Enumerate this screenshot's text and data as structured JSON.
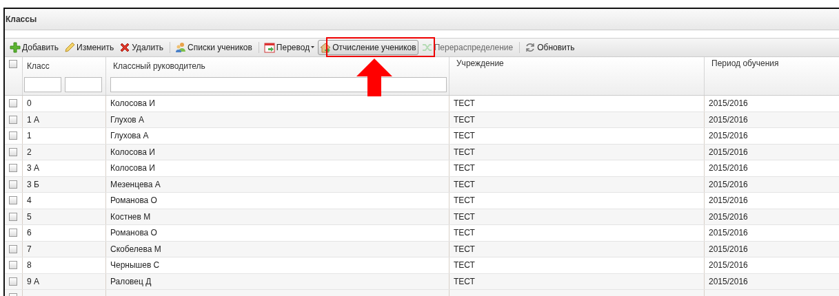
{
  "window": {
    "title": "Классы"
  },
  "toolbar": [
    {
      "kind": "button",
      "label": "Добавить",
      "disabled": false,
      "pressed": false,
      "dropdown": false
    },
    {
      "kind": "button",
      "label": "Изменить",
      "disabled": false,
      "pressed": false,
      "dropdown": false
    },
    {
      "kind": "button",
      "label": "Удалить",
      "disabled": false,
      "pressed": false,
      "dropdown": false
    },
    {
      "kind": "separator"
    },
    {
      "kind": "button",
      "label": "Списки учеников",
      "disabled": false,
      "pressed": false,
      "dropdown": false
    },
    {
      "kind": "separator"
    },
    {
      "kind": "button",
      "label": "Перевод",
      "disabled": false,
      "pressed": false,
      "dropdown": true
    },
    {
      "kind": "button",
      "label": "Отчисление учеников",
      "disabled": false,
      "pressed": true,
      "dropdown": false
    },
    {
      "kind": "button",
      "label": "Перераспределение",
      "disabled": true,
      "pressed": false,
      "dropdown": false
    },
    {
      "kind": "separator"
    },
    {
      "kind": "button",
      "label": "Обновить",
      "disabled": false,
      "pressed": false,
      "dropdown": false
    }
  ],
  "table": {
    "select_all_checked": false,
    "columns": [
      "Класс",
      "Классный руководитель",
      "Учреждение",
      "Период обучения"
    ],
    "rows": [
      {
        "checked": false,
        "cells": [
          "0",
          "Колосова И",
          "ТЕСТ",
          "2015/2016"
        ]
      },
      {
        "checked": false,
        "cells": [
          "1 А",
          "Глухов А",
          "ТЕСТ",
          "2015/2016"
        ]
      },
      {
        "checked": false,
        "cells": [
          "1",
          "Глухова А",
          "ТЕСТ",
          "2015/2016"
        ]
      },
      {
        "checked": false,
        "cells": [
          "2",
          "Колосова И",
          "ТЕСТ",
          "2015/2016"
        ]
      },
      {
        "checked": false,
        "cells": [
          "3 А",
          "Колосова И",
          "ТЕСТ",
          "2015/2016"
        ]
      },
      {
        "checked": false,
        "cells": [
          "3 Б",
          "Мезенцева А",
          "ТЕСТ",
          "2015/2016"
        ]
      },
      {
        "checked": false,
        "cells": [
          "4",
          "Романова О",
          "ТЕСТ",
          "2015/2016"
        ]
      },
      {
        "checked": false,
        "cells": [
          "5",
          "Костнев М",
          "ТЕСТ",
          "2015/2016"
        ]
      },
      {
        "checked": false,
        "cells": [
          "6",
          "Романова О",
          "ТЕСТ",
          "2015/2016"
        ]
      },
      {
        "checked": false,
        "cells": [
          "7",
          "Скобелева М",
          "ТЕСТ",
          "2015/2016"
        ]
      },
      {
        "checked": false,
        "cells": [
          "8",
          "Чернышев С",
          "ТЕСТ",
          "2015/2016"
        ]
      },
      {
        "checked": false,
        "cells": [
          "9 А",
          "Раловец Д",
          "ТЕСТ",
          "2015/2016"
        ]
      }
    ]
  }
}
